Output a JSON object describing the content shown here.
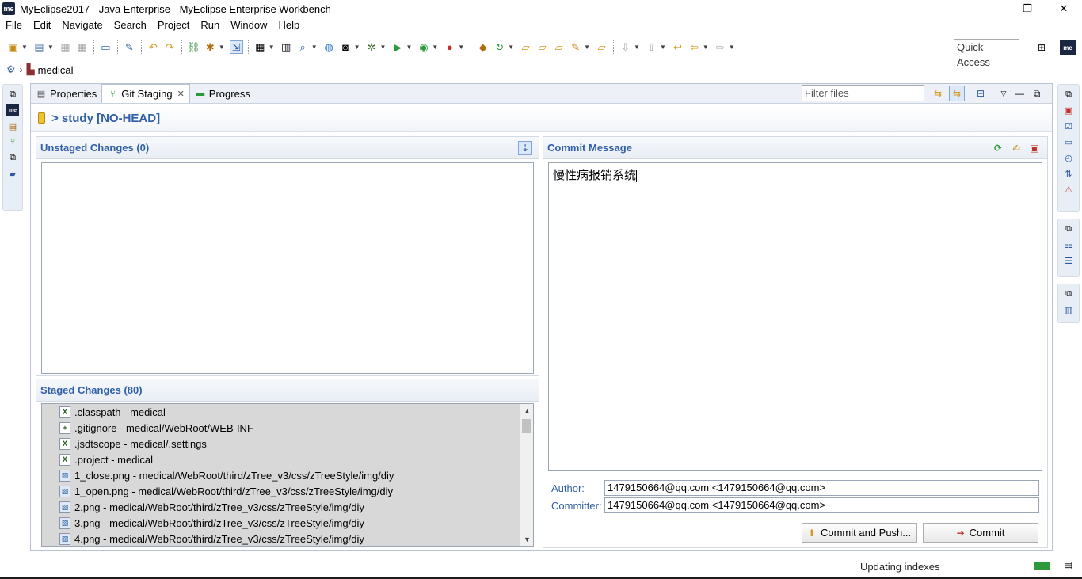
{
  "window": {
    "title": "MyEclipse2017 - Java Enterprise - MyEclipse Enterprise Workbench",
    "logo_text": "me",
    "minimize": "—",
    "restore": "❐",
    "close": "✕"
  },
  "menu": {
    "items": [
      "File",
      "Edit",
      "Navigate",
      "Search",
      "Project",
      "Run",
      "Window",
      "Help"
    ]
  },
  "toolbar": {
    "quick_access": "Quick Access"
  },
  "breadcrumb": {
    "project": "medical"
  },
  "view": {
    "tabs": [
      {
        "label": "Properties"
      },
      {
        "label": "Git Staging"
      },
      {
        "label": "Progress"
      }
    ],
    "filter_placeholder": "Filter files"
  },
  "staging": {
    "repo_title": "> study [NO-HEAD]",
    "unstaged_title": "Unstaged Changes (0)",
    "staged_title": "Staged Changes (80)",
    "staged_files": [
      {
        "label": ".classpath - medical",
        "icon": "xml-file-icon"
      },
      {
        "label": ".gitignore - medical/WebRoot/WEB-INF",
        "icon": "text-file-icon"
      },
      {
        "label": ".jsdtscope - medical/.settings",
        "icon": "xml-file-icon"
      },
      {
        "label": ".project - medical",
        "icon": "xml-file-icon"
      },
      {
        "label": "1_close.png - medical/WebRoot/third/zTree_v3/css/zTreeStyle/img/diy",
        "icon": "image-file-icon"
      },
      {
        "label": "1_open.png - medical/WebRoot/third/zTree_v3/css/zTreeStyle/img/diy",
        "icon": "image-file-icon"
      },
      {
        "label": "2.png - medical/WebRoot/third/zTree_v3/css/zTreeStyle/img/diy",
        "icon": "image-file-icon"
      },
      {
        "label": "3.png - medical/WebRoot/third/zTree_v3/css/zTreeStyle/img/diy",
        "icon": "image-file-icon"
      },
      {
        "label": "4.png - medical/WebRoot/third/zTree_v3/css/zTreeStyle/img/diy",
        "icon": "image-file-icon"
      }
    ],
    "commit_title": "Commit Message",
    "commit_message": "慢性病报销系统",
    "author_label": "Author:",
    "author_value": "1479150664@qq.com <1479150664@qq.com>",
    "committer_label": "Committer:",
    "committer_value": "1479150664@qq.com <1479150664@qq.com>",
    "commit_push_label": "Commit and Push...",
    "commit_label": "Commit"
  },
  "status": {
    "text": "Updating indexes"
  }
}
